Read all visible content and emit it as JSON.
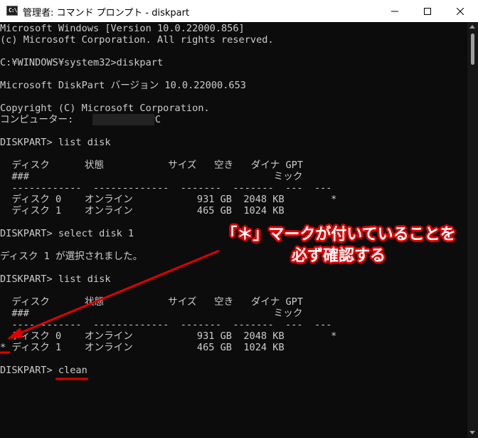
{
  "window": {
    "title": "管理者: コマンド プロンプト - diskpart",
    "icon": "cmd-icon",
    "controls": [
      "minimize-icon",
      "maximize-icon",
      "close-icon"
    ]
  },
  "console": {
    "lines": [
      "Microsoft Windows [Version 10.0.22000.856]",
      "(c) Microsoft Corporation. All rights reserved.",
      "",
      "C:¥WINDOWS¥system32>diskpart",
      "",
      "Microsoft DiskPart バージョン 10.0.22000.653",
      "",
      "Copyright (C) Microsoft Corporation.",
      "コンピューター:            -PC",
      "",
      "DISKPART> list disk",
      "",
      "  ディスク      状態           サイズ   空き   ダイナ GPT",
      "  ###                                          ミック",
      "  ------------  -------------  -------  -------  ---  ---",
      "  ディスク 0    オンライン           931 GB  2048 KB        *",
      "  ディスク 1    オンライン           465 GB  1024 KB",
      "",
      "DISKPART> select disk 1",
      "",
      "ディスク 1 が選択されました。",
      "",
      "DISKPART> list disk",
      "",
      "  ディスク      状態           サイズ   空き   ダイナ GPT",
      "  ###                                          ミック",
      "  ------------  -------------  -------  -------  ---  ---",
      "  ディスク 0    オンライン           931 GB  2048 KB        *",
      "* ディスク 1    オンライン           465 GB  1024 KB",
      "",
      "DISKPART> clean"
    ]
  },
  "annotation": {
    "line1": "「＊」マークが付いていることを",
    "line2": "必ず確認する",
    "color": "#e00000"
  },
  "colors": {
    "console_bg": "#0c0c0c",
    "console_text": "#cccccc",
    "annotation_red": "#e00000"
  }
}
